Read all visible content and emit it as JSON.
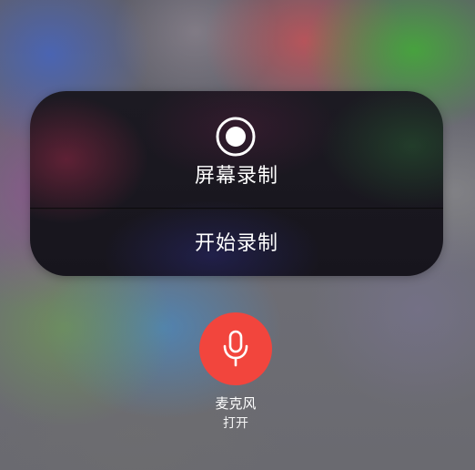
{
  "screen_recording": {
    "icon": "record-icon",
    "title": "屏幕录制",
    "start_label": "开始录制"
  },
  "microphone": {
    "icon": "microphone-icon",
    "label": "麦克风",
    "status": "打开",
    "enabled": true,
    "accent_color": "#f2453d"
  }
}
